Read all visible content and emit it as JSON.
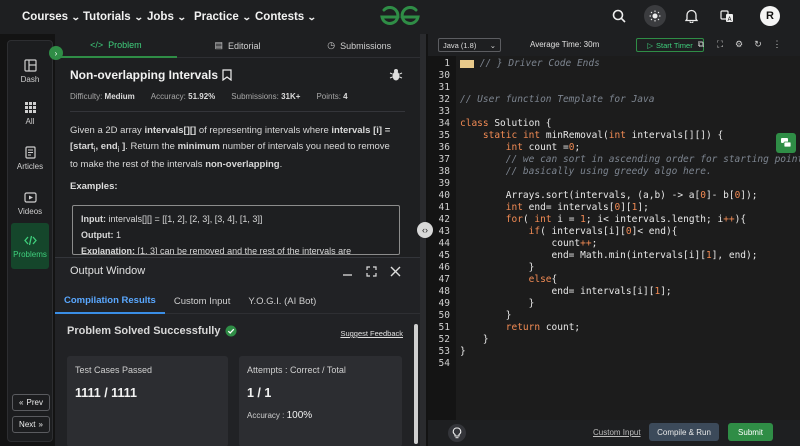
{
  "nav": {
    "items": [
      "Courses",
      "Tutorials",
      "Jobs",
      "Practice",
      "Contests"
    ],
    "avatar": "R"
  },
  "sidebar": {
    "items": [
      {
        "label": "Dash",
        "icon": "dashboard-icon"
      },
      {
        "label": "All",
        "icon": "grid-icon"
      },
      {
        "label": "Articles",
        "icon": "article-icon"
      },
      {
        "label": "Videos",
        "icon": "video-icon"
      },
      {
        "label": "Problems",
        "icon": "code-icon"
      }
    ],
    "prev": "Prev",
    "next": "Next"
  },
  "problem": {
    "tabs": [
      "Problem",
      "Editorial",
      "Submissions"
    ],
    "title": "Non-overlapping Intervals",
    "meta": {
      "difficulty_label": "Difficulty:",
      "difficulty": "Medium",
      "accuracy_label": "Accuracy:",
      "accuracy": "51.92%",
      "submissions_label": "Submissions:",
      "submissions": "31K+",
      "points_label": "Points:",
      "points": "4"
    },
    "description": {
      "p1": "Given a 2D array ",
      "b1": "intervals[][]",
      "p2": " of representing intervals where ",
      "b2": "intervals [i] = [start",
      "s1": "i",
      "b3": ", end",
      "s2": "i",
      "b4": " ]",
      "p3": ". Return the ",
      "b5": "minimum",
      "p4": " number of intervals you need to remove to make the rest of the intervals ",
      "b6": "non-overlapping",
      "p5": "."
    },
    "examples_heading": "Examples:",
    "example": {
      "input_label": "Input:",
      "input": " intervals[][] = [[1, 2], [2, 3], [3, 4], [1, 3]]",
      "output_label": "Output:",
      "output": " 1",
      "explanation_label": "Explanation:",
      "explanation": " [1, 3] can be removed and the rest of the intervals are"
    }
  },
  "output_window": {
    "title": "Output Window",
    "tabs": [
      "Compilation Results",
      "Custom Input",
      "Y.O.G.I. (AI Bot)"
    ],
    "status": "Problem Solved Successfully",
    "feedback": "Suggest Feedback",
    "test_cases_label": "Test Cases Passed",
    "test_cases": "1111 / 1111",
    "attempts_label": "Attempts : Correct / Total",
    "attempts": "1 / 1",
    "accuracy_label": "Accuracy : ",
    "accuracy": "100%"
  },
  "editor": {
    "language": "Java (1.8)",
    "avg_time_label": "Average Time:",
    "avg_time": "30m",
    "timer": "Start Timer",
    "custom_input": "Custom Input",
    "compile": "Compile & Run",
    "submit": "Submit",
    "lines": [
      {
        "n": "1",
        "code": " // } Driver Code Ends"
      },
      {
        "n": "30",
        "code": ""
      },
      {
        "n": "31",
        "code": ""
      },
      {
        "n": "32",
        "code": "// User function Template for Java"
      },
      {
        "n": "33",
        "code": ""
      },
      {
        "n": "34",
        "code": "class Solution {"
      },
      {
        "n": "35",
        "code": "    static int minRemoval(int intervals[][]) {"
      },
      {
        "n": "36",
        "code": "        int count =0;"
      },
      {
        "n": "37",
        "code": "        // we can sort in ascending order for starting point"
      },
      {
        "n": "38",
        "code": "        // basically using greedy algo here."
      },
      {
        "n": "39",
        "code": ""
      },
      {
        "n": "40",
        "code": "        Arrays.sort(intervals, (a,b) -> a[0]- b[0]);"
      },
      {
        "n": "41",
        "code": "        int end= intervals[0][1];"
      },
      {
        "n": "42",
        "code": "        for( int i = 1; i< intervals.length; i++){"
      },
      {
        "n": "43",
        "code": "            if( intervals[i][0]< end){"
      },
      {
        "n": "44",
        "code": "                count++;"
      },
      {
        "n": "45",
        "code": "                end= Math.min(intervals[i][1], end);"
      },
      {
        "n": "46",
        "code": "            }"
      },
      {
        "n": "47",
        "code": "            else{"
      },
      {
        "n": "48",
        "code": "                end= intervals[i][1];"
      },
      {
        "n": "49",
        "code": "            }"
      },
      {
        "n": "50",
        "code": "        }"
      },
      {
        "n": "51",
        "code": "        return count;"
      },
      {
        "n": "52",
        "code": "    }"
      },
      {
        "n": "53",
        "code": "}"
      },
      {
        "n": "54",
        "code": ""
      }
    ]
  },
  "colors": {
    "accent_green": "#2f8d46",
    "link_blue": "#3a8ee6",
    "keyword_orange": "#f28b54"
  }
}
